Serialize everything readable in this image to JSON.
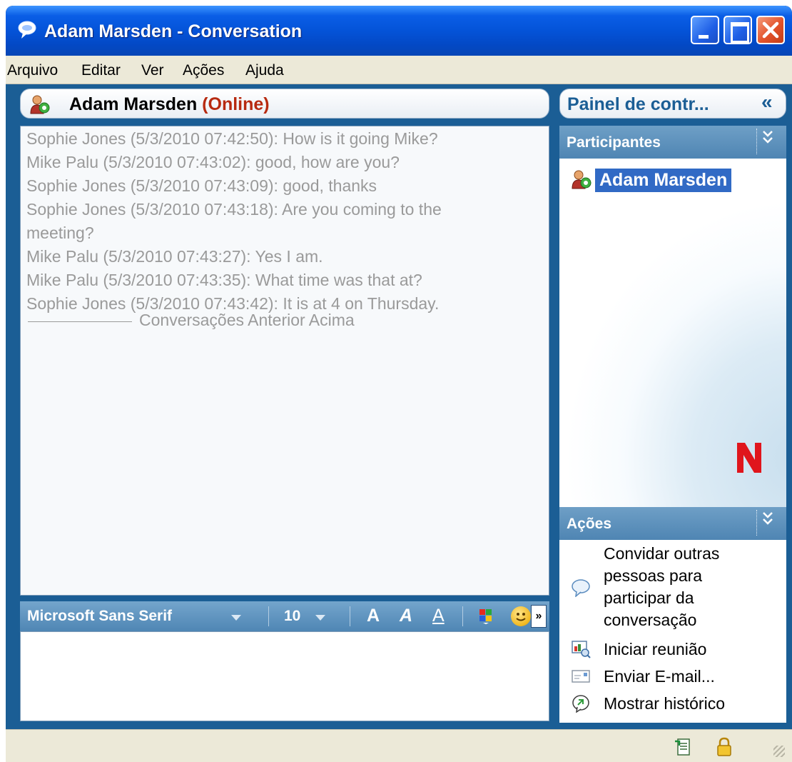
{
  "window": {
    "title": "Adam Marsden - Conversation"
  },
  "menu": {
    "items": [
      "Arquivo",
      "Editar",
      "Ver",
      "Ações",
      "Ajuda"
    ]
  },
  "conversation": {
    "contact_name": "Adam Marsden",
    "status": "(Online)",
    "messages": [
      "Sophie Jones  (5/3/2010 07:42:50): How is it going Mike?",
      "Mike Palu  (5/3/2010 07:43:02): good, how are you?",
      "Sophie Jones  (5/3/2010 07:43:09): good, thanks",
      "Sophie Jones  (5/3/2010 07:43:18): Are you coming to the",
      "meeting?",
      "Mike Palu  (5/3/2010 07:43:27): Yes I am.",
      "Mike Palu  (5/3/2010 07:43:35): What time was that at?",
      "Sophie Jones  (5/3/2010 07:43:42): It is at 4 on Thursday."
    ],
    "separator_text": "Conversações Anterior Acima"
  },
  "toolbar": {
    "font_name": "Microsoft Sans Serif",
    "font_size": "10",
    "bold": "A",
    "italic": "A",
    "underline": "A",
    "more": "»"
  },
  "side_panel": {
    "title": "Painel de contr...",
    "collapse_glyph": "«",
    "participants_title": "Participantes",
    "participants": [
      "Adam Marsden"
    ],
    "section_chevron": "»",
    "logo_letter": "N",
    "actions_title": "Ações",
    "actions": [
      {
        "label_lines": [
          "Convidar outras",
          "pessoas para",
          "participar da",
          "conversação"
        ],
        "icon": "chat-bubble-icon"
      },
      {
        "label_lines": [
          "Iniciar reunião"
        ],
        "icon": "meeting-icon"
      },
      {
        "label_lines": [
          "Enviar E-mail..."
        ],
        "icon": "email-icon"
      },
      {
        "label_lines": [
          "Mostrar histórico"
        ],
        "icon": "history-icon"
      }
    ]
  },
  "status_icons": [
    "notes-icon",
    "lock-icon"
  ],
  "colors": {
    "titlebar": "#0453d8",
    "client": "#1b5e95",
    "status_online": "#b72a10",
    "selection": "#316ac5",
    "menu_bg": "#ece9d8"
  }
}
